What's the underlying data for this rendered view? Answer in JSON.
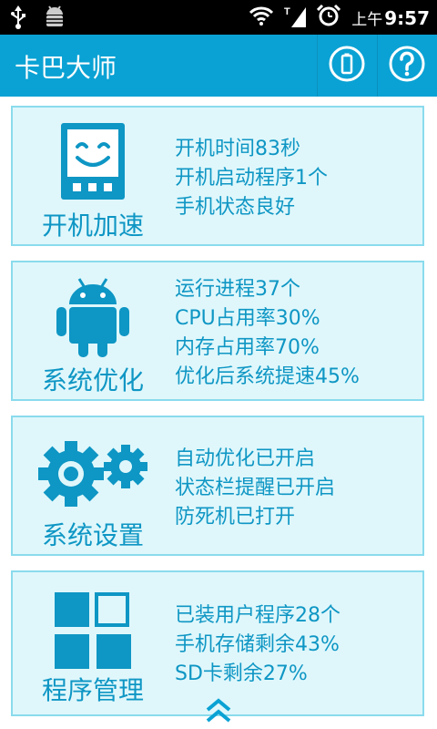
{
  "status_bar": {
    "left_icons": [
      "usb-icon",
      "android-debug-icon"
    ],
    "right_icons": [
      "wifi-icon",
      "signal-icon",
      "alarm-icon"
    ],
    "time_ampm": "上午",
    "time": "9:57"
  },
  "header": {
    "title": "卡巴大师",
    "buttons": [
      {
        "name": "battery-button",
        "icon": "battery-icon"
      },
      {
        "name": "help-button",
        "icon": "help-icon"
      }
    ]
  },
  "colors": {
    "accent": "#0aa2d4",
    "text_blue": "#0e96c4",
    "card_bg": "#dff7fb",
    "card_border": "#8adbed"
  },
  "cards": [
    {
      "title": "开机加速",
      "icon": "phone-smile-icon",
      "lines": [
        "开机时间83秒",
        "开机启动程序1个",
        "手机状态良好"
      ]
    },
    {
      "title": "系统优化",
      "icon": "android-icon",
      "lines": [
        "运行进程37个",
        "CPU占用率30%",
        "内存占用率70%",
        "优化后系统提速45%"
      ]
    },
    {
      "title": "系统设置",
      "icon": "gears-icon",
      "lines": [
        "自动优化已开启",
        "状态栏提醒已开启",
        "防死机已打开"
      ]
    },
    {
      "title": "程序管理",
      "icon": "app-grid-icon",
      "lines": [
        "已装用户程序28个",
        "手机存储剩余43%",
        "SD卡剩余27%"
      ]
    }
  ],
  "footer": {
    "icon": "double-chevron-up-icon"
  }
}
